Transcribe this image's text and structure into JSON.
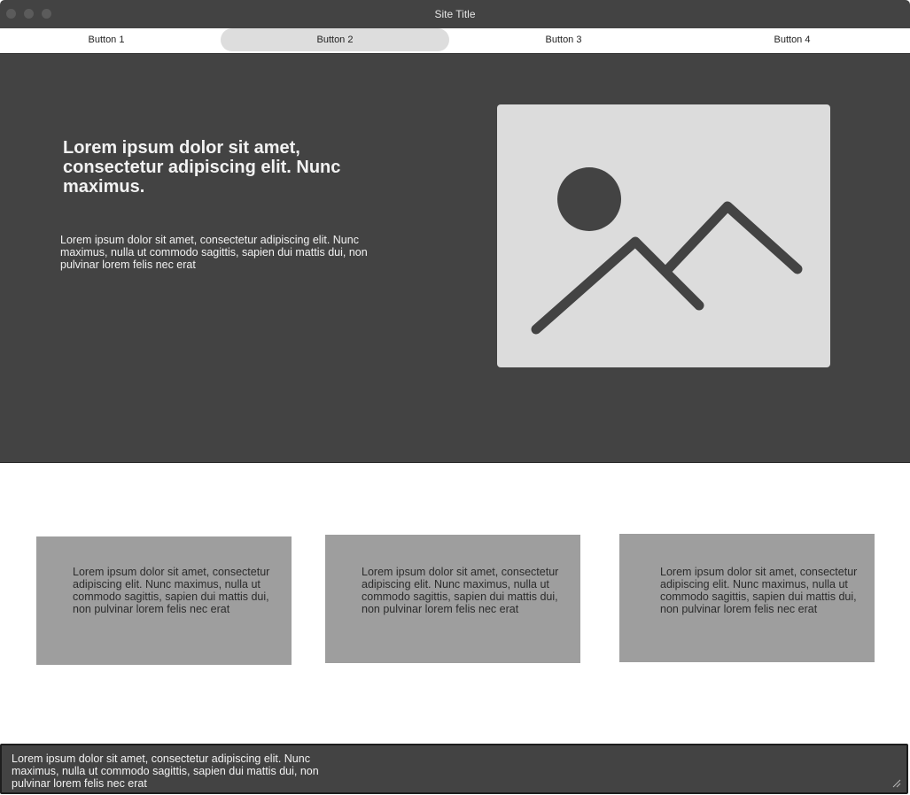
{
  "window": {
    "title": "Site Title"
  },
  "nav": {
    "buttons": [
      "Button 1",
      "Button 2",
      "Button 3",
      "Button 4"
    ],
    "active_index": 1
  },
  "hero": {
    "heading": "Lorem ipsum dolor sit amet, consectetur adipiscing elit. Nunc maximus.",
    "body": "Lorem ipsum dolor sit amet, consectetur adipiscing elit. Nunc maximus, nulla ut commodo sagittis, sapien dui mattis dui, non pulvinar lorem felis nec erat",
    "image_icon": "image-placeholder-icon"
  },
  "cards": [
    {
      "text": "Lorem ipsum dolor sit amet, consectetur adipiscing elit. Nunc maximus, nulla ut commodo sagittis, sapien dui mattis dui, non pulvinar lorem felis nec erat"
    },
    {
      "text": "Lorem ipsum dolor sit amet, consectetur adipiscing elit. Nunc maximus, nulla ut commodo sagittis, sapien dui mattis dui, non pulvinar lorem felis nec erat"
    },
    {
      "text": "Lorem ipsum dolor sit amet, consectetur adipiscing elit. Nunc maximus, nulla ut commodo sagittis, sapien dui mattis dui, non pulvinar lorem felis nec erat"
    }
  ],
  "footer": {
    "textarea_value": "Lorem ipsum dolor sit amet, consectetur adipiscing elit. Nunc maximus, nulla ut commodo sagittis, sapien dui mattis dui, non pulvinar lorem felis nec erat"
  },
  "colors": {
    "dark_panel": "#434343",
    "light_panel": "#dcdcdc",
    "card": "#9e9e9e",
    "active_nav": "#dddddd"
  }
}
